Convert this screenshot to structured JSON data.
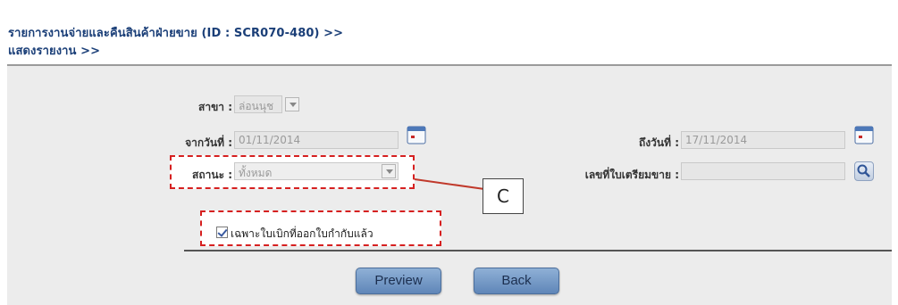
{
  "header": {
    "title_line1": "รายการงานจ่ายและคืนสินค้าฝ่ายขาย (ID : SCR070-480) >>",
    "title_line2": "แสดงรายงาน >>"
  },
  "form": {
    "branch_label": "สาขา :",
    "branch_value": "ล่อนนุช",
    "from_date_label": "จากวันที่ :",
    "from_date_value": "01/11/2014",
    "to_date_label": "ถึงวันที่ :",
    "to_date_value": "17/11/2014",
    "status_label": "สถานะ :",
    "status_value": "ทั้งหมด",
    "prep_no_label": "เลขที่ใบเตรียมขาย :",
    "prep_no_value": "",
    "invoice_only_label": "เฉพาะใบเบิกที่ออกใบกำกับแล้ว",
    "invoice_only_checked": true
  },
  "annotation": {
    "callout_label": "C"
  },
  "buttons": {
    "preview": "Preview",
    "back": "Back"
  }
}
